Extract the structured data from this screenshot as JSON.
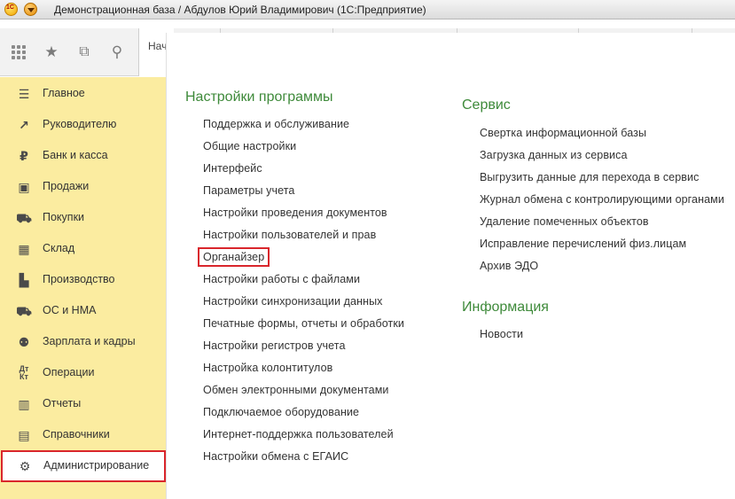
{
  "window": {
    "title": "Демонстрационная база / Абдулов Юрий Владимирович  (1С:Предприятие)"
  },
  "toolbar": {
    "start_tab_label": "Нач стра"
  },
  "sidebar": {
    "items": [
      {
        "label": "Главное",
        "icon": "menu-lines-icon"
      },
      {
        "label": "Руководителю",
        "icon": "trend-icon"
      },
      {
        "label": "Банк и касса",
        "icon": "ruble-icon"
      },
      {
        "label": "Продажи",
        "icon": "bag-icon"
      },
      {
        "label": "Покупки",
        "icon": "cart-icon"
      },
      {
        "label": "Склад",
        "icon": "warehouse-icon"
      },
      {
        "label": "Производство",
        "icon": "factory-icon"
      },
      {
        "label": "ОС и НМА",
        "icon": "truck-icon"
      },
      {
        "label": "Зарплата и кадры",
        "icon": "people-icon"
      },
      {
        "label": "Операции",
        "icon": "dt-kt-icon"
      },
      {
        "label": "Отчеты",
        "icon": "bar-chart-icon"
      },
      {
        "label": "Справочники",
        "icon": "book-icon"
      },
      {
        "label": "Администрирование",
        "icon": "gear-icon",
        "active": true
      }
    ]
  },
  "settings": {
    "title": "Настройки программы",
    "links": [
      "Поддержка и обслуживание",
      "Общие настройки",
      "Интерфейс",
      "Параметры учета",
      "Настройки проведения документов",
      "Настройки пользователей и прав",
      "Органайзер",
      "Настройки работы с файлами",
      "Настройки синхронизации данных",
      "Печатные формы, отчеты и обработки",
      "Настройки регистров учета",
      "Настройка колонтитулов",
      "Обмен электронными документами",
      "Подключаемое оборудование",
      "Интернет-поддержка пользователей",
      "Настройки обмена с ЕГАИС"
    ]
  },
  "service": {
    "title": "Сервис",
    "links": [
      "Свертка информационной базы",
      "Загрузка данных из сервиса",
      "Выгрузить данные для перехода в сервис",
      "Журнал обмена с контролирующими органами",
      "Удаление помеченных объектов",
      "Исправление перечислений физ.лицам",
      "Архив ЭДО"
    ]
  },
  "info": {
    "title": "Информация",
    "links": [
      "Новости"
    ]
  },
  "colors": {
    "sidebar_bg": "#fbeca0",
    "section_title": "#3e8a3a",
    "highlight": "#d9262c"
  }
}
